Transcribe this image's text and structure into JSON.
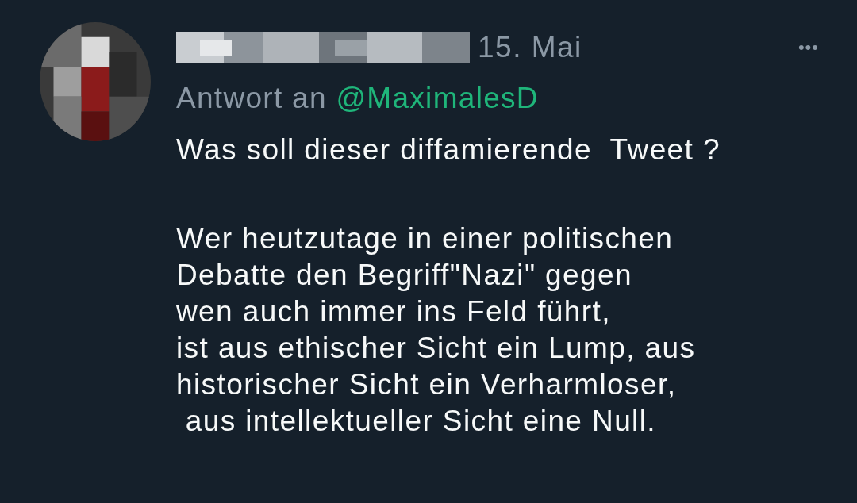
{
  "tweet": {
    "author": {
      "redacted": true
    },
    "date": "15. Mai",
    "more": "•••",
    "reply_label": "Antwort an",
    "reply_handle": "@MaximalesD",
    "paragraphs": [
      "Was soll dieser diffamierende  Tweet ?",
      "Wer heutzutage in einer politischen\nDebatte den Begriff\"Nazi\" gegen\nwen auch immer ins Feld führt,\nist aus ethischer Sicht ein Lump, aus\nhistorischer Sicht ein Verharmloser,\n aus intellektueller Sicht eine Null."
    ]
  }
}
